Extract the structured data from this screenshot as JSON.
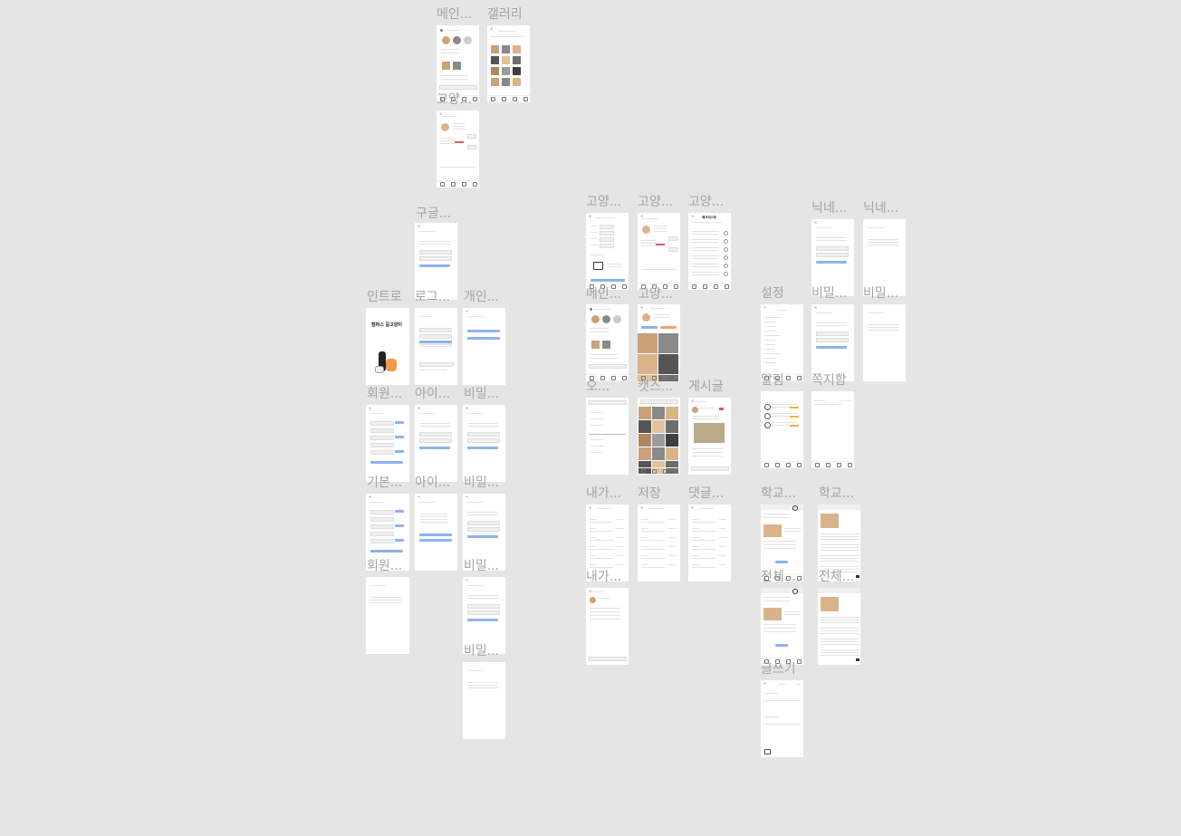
{
  "frames": [
    {
      "label": "메인...",
      "kind": "main"
    },
    {
      "label": "갤러리",
      "kind": "gallery"
    },
    {
      "label": "고양...",
      "kind": "catinfo"
    },
    {
      "label": "구글...",
      "kind": "form"
    },
    {
      "label": "인트로",
      "kind": "intro"
    },
    {
      "label": "로그...",
      "kind": "login"
    },
    {
      "label": "개인...",
      "kind": "blank2"
    },
    {
      "label": "회원...",
      "kind": "signup"
    },
    {
      "label": "아이...",
      "kind": "form"
    },
    {
      "label": "비밀...",
      "kind": "form"
    },
    {
      "label": "기본...",
      "kind": "signup"
    },
    {
      "label": "아이...",
      "kind": "result"
    },
    {
      "label": "비밀...",
      "kind": "form"
    },
    {
      "label": "회원...",
      "kind": "textonly"
    },
    {
      "label": "비밀...",
      "kind": "form"
    },
    {
      "label": "비밀...",
      "kind": "textonly"
    },
    {
      "label": "고양...",
      "kind": "catreg"
    },
    {
      "label": "고양...",
      "kind": "catinfo"
    },
    {
      "label": "고양...",
      "kind": "checklist"
    },
    {
      "label": "메인...",
      "kind": "main"
    },
    {
      "label": "고양...",
      "kind": "catdetail"
    },
    {
      "label": "오...",
      "kind": "menu"
    },
    {
      "label": "캣스...",
      "kind": "catsgallery"
    },
    {
      "label": "게시글",
      "kind": "post"
    },
    {
      "label": "내가...",
      "kind": "mylist"
    },
    {
      "label": "저장",
      "kind": "mylist"
    },
    {
      "label": "댓글...",
      "kind": "mylist"
    },
    {
      "label": "내가...",
      "kind": "comment"
    },
    {
      "label": "닉네...",
      "kind": "form"
    },
    {
      "label": "닉네...",
      "kind": "textonly"
    },
    {
      "label": "설정",
      "kind": "settings"
    },
    {
      "label": "비밀...",
      "kind": "form"
    },
    {
      "label": "비밀...",
      "kind": "textonly"
    },
    {
      "label": "알림",
      "kind": "notify"
    },
    {
      "label": "쪽지함",
      "kind": "message"
    },
    {
      "label": "학교...",
      "kind": "board"
    },
    {
      "label": "학교...",
      "kind": "boardcol"
    },
    {
      "label": "전체...",
      "kind": "board"
    },
    {
      "label": "전체...",
      "kind": "boardcol"
    },
    {
      "label": "글쓰기",
      "kind": "write"
    }
  ],
  "intro_title": "캠퍼스 길고양이",
  "checklist_title": "체크리스트",
  "colors": {
    "accent": "#8bb3ee",
    "orange": "#f4a36e",
    "canvas": "#e5e5e5"
  }
}
